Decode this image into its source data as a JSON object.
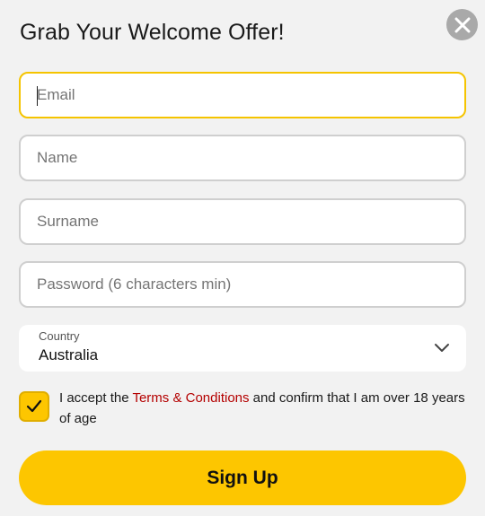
{
  "modal": {
    "title": "Grab Your Welcome Offer!",
    "close_icon": "close-icon"
  },
  "form": {
    "email_placeholder": "Email",
    "name_placeholder": "Name",
    "surname_placeholder": "Surname",
    "password_placeholder": "Password (6 characters min)",
    "country": {
      "label": "Country",
      "value": "Australia",
      "icon": "chevron-down-icon"
    },
    "consent": {
      "checked": true,
      "text_before": "I accept the ",
      "link_text": "Terms & Conditions",
      "text_after": " and confirm that I am over 18 years of age"
    },
    "submit_label": "Sign Up"
  },
  "colors": {
    "accent": "#fdc600",
    "focus_border": "#f5c400",
    "link": "#b40000",
    "close_button": "#a9a9a9"
  }
}
